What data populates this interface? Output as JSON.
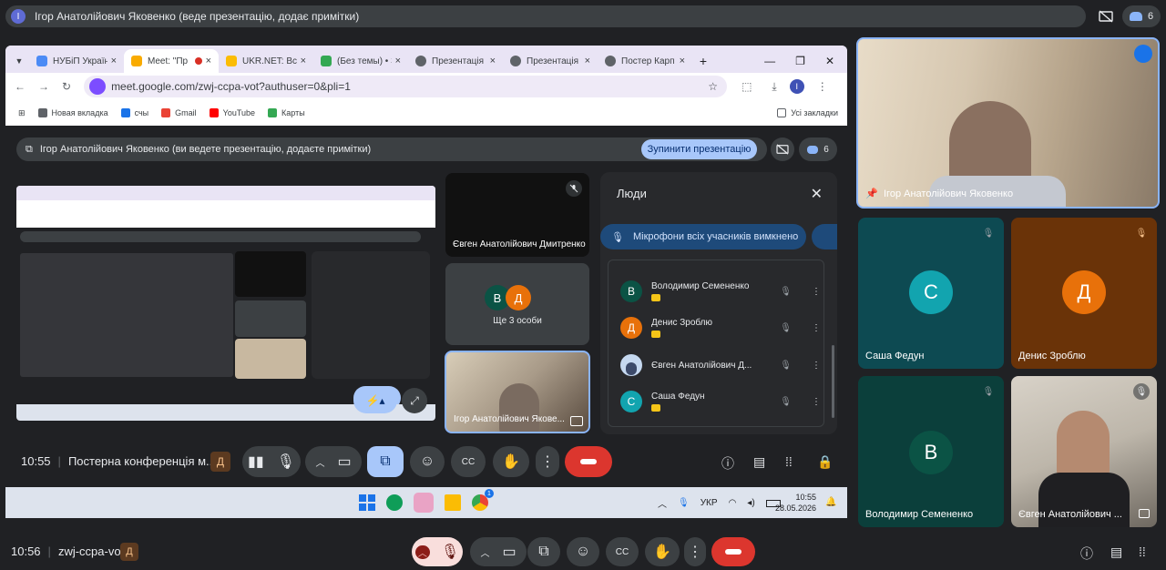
{
  "top_banner": {
    "avatar_letter": "І",
    "text": "Ігор Анатолійович Яковенко (веде презентацію, додає примітки)",
    "participants_count": "6"
  },
  "browser": {
    "tabs": [
      {
        "label": "НУБіП Україн",
        "icon_color": "#4c8bf5"
      },
      {
        "label": "Meet: \"Пр",
        "icon_color": "#f9ab00",
        "active": true
      },
      {
        "label": "UKR.NET: Всі н",
        "icon_color": "#fbbc04"
      },
      {
        "label": "(Без темы) • З",
        "icon_color": "#34a853"
      },
      {
        "label": "Презентація",
        "icon_color": "#5f6368"
      },
      {
        "label": "Презентація",
        "icon_color": "#5f6368"
      },
      {
        "label": "Постер Карп",
        "icon_color": "#5f6368"
      }
    ],
    "url": "meet.google.com/zwj-ccpa-vot?authuser=0&pli=1",
    "profile_letter": "I",
    "bookmarks": [
      {
        "label": "Новая вкладка",
        "color": "#5f6368"
      },
      {
        "label": "счы",
        "color": "#1a73e8"
      },
      {
        "label": "Gmail",
        "color": "#ea4335"
      },
      {
        "label": "YouTube",
        "color": "#ff0000"
      },
      {
        "label": "Карты",
        "color": "#34a853"
      }
    ],
    "all_bookmarks": "Усі закладки"
  },
  "presentation_bar": {
    "text": "Ігор Анатолійович Яковенко (ви ведете презентацію, додаєте примітки)",
    "stop_button": "Зупинити презентацію",
    "count": "6"
  },
  "inner_tiles": {
    "tile1_name": "Євген Анатолійович Дмитренко",
    "tile2_label": "Ще 3 особи",
    "tile2_av1": "В",
    "tile2_av2": "Д",
    "tile3_name": "Ігор Анатолійович Якове..."
  },
  "people_panel": {
    "title": "Люди",
    "mute_all": "Мікрофони всіх учасників вимкнено",
    "people": [
      {
        "letter": "В",
        "name": "Володимир Семененко",
        "color": "#0b5345"
      },
      {
        "letter": "Д",
        "name": "Денис Зроблю",
        "color": "#e8710a"
      },
      {
        "letter": "",
        "name": "Євген Анатолійович Д...",
        "color": "#8ab4f8"
      },
      {
        "letter": "С",
        "name": "Саша Федун",
        "color": "#12a4af"
      }
    ]
  },
  "inner_controls": {
    "time": "10:55",
    "title": "Постерна конференція м...",
    "avatar_letter": "Д"
  },
  "taskbar": {
    "lang": "УКР",
    "time": "10:55",
    "date": "28.05.2026",
    "badge": "1"
  },
  "right_tiles": {
    "presenter_name": "Ігор Анатолійович Яковенко",
    "tiles": [
      {
        "letter": "С",
        "name": "Саша Федун",
        "bg": "#0d4a52",
        "circle": "#12a4af"
      },
      {
        "letter": "Д",
        "name": "Денис Зроблю",
        "bg": "#6a3308",
        "circle": "#e8710a"
      },
      {
        "letter": "В",
        "name": "Володимир Семененко",
        "bg": "#0b3f3b",
        "circle": "#0b5345"
      },
      {
        "letter": "",
        "name": "Євген Анатолійович ...",
        "bg": "#8a8580",
        "circle": ""
      }
    ]
  },
  "bottom_bar": {
    "time": "10:56",
    "code": "zwj-ccpa-vot",
    "avatar_letter": "Д"
  }
}
